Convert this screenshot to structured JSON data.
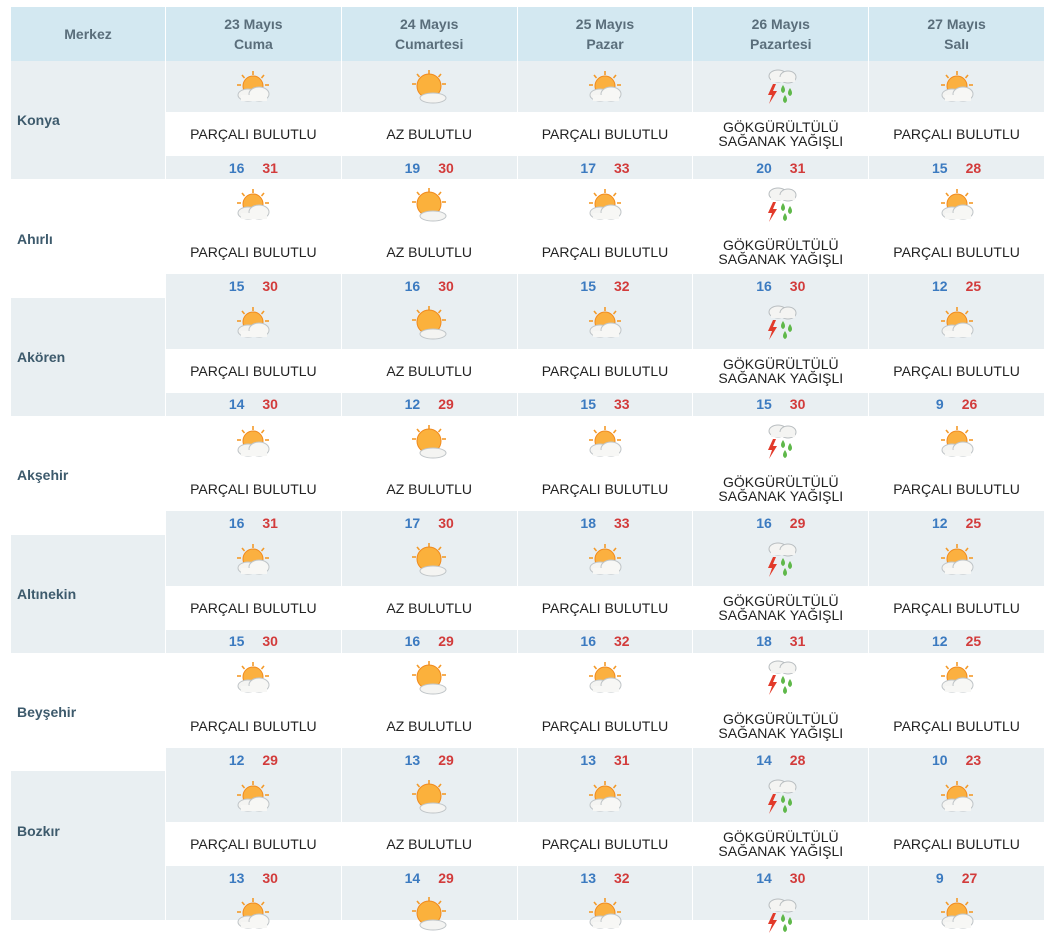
{
  "header": {
    "merkez": "Merkez",
    "days": [
      {
        "date": "23 Mayıs",
        "weekday": "Cuma"
      },
      {
        "date": "24 Mayıs",
        "weekday": "Cumartesi"
      },
      {
        "date": "25 Mayıs",
        "weekday": "Pazar"
      },
      {
        "date": "26 Mayıs",
        "weekday": "Pazartesi"
      },
      {
        "date": "27 Mayıs",
        "weekday": "Salı"
      }
    ]
  },
  "colors": {
    "header_bg": "#d3e8f1",
    "stripe_bg": "#e9eff2",
    "min_temp": "#3b7ac0",
    "max_temp": "#d23b3b"
  },
  "cities": [
    {
      "name": "Konya",
      "forecast": [
        {
          "icon": "partly-cloudy-icon",
          "desc": "PARÇALI BULUTLU",
          "min": "16",
          "max": "31"
        },
        {
          "icon": "mostly-sunny-icon",
          "desc": "AZ BULUTLU",
          "min": "19",
          "max": "30"
        },
        {
          "icon": "partly-cloudy-icon",
          "desc": "PARÇALI BULUTLU",
          "min": "17",
          "max": "33"
        },
        {
          "icon": "thunderstorm-icon",
          "desc": "GÖKGÜRÜLTÜLÜ SAĞANAK YAĞIŞLI",
          "min": "20",
          "max": "31"
        },
        {
          "icon": "partly-cloudy-icon",
          "desc": "PARÇALI BULUTLU",
          "min": "15",
          "max": "28"
        }
      ]
    },
    {
      "name": "Ahırlı",
      "forecast": [
        {
          "icon": "partly-cloudy-icon",
          "desc": "PARÇALI BULUTLU",
          "min": "15",
          "max": "30"
        },
        {
          "icon": "mostly-sunny-icon",
          "desc": "AZ BULUTLU",
          "min": "16",
          "max": "30"
        },
        {
          "icon": "partly-cloudy-icon",
          "desc": "PARÇALI BULUTLU",
          "min": "15",
          "max": "32"
        },
        {
          "icon": "thunderstorm-icon",
          "desc": "GÖKGÜRÜLTÜLÜ SAĞANAK YAĞIŞLI",
          "min": "16",
          "max": "30"
        },
        {
          "icon": "partly-cloudy-icon",
          "desc": "PARÇALI BULUTLU",
          "min": "12",
          "max": "25"
        }
      ]
    },
    {
      "name": "Akören",
      "forecast": [
        {
          "icon": "partly-cloudy-icon",
          "desc": "PARÇALI BULUTLU",
          "min": "14",
          "max": "30"
        },
        {
          "icon": "mostly-sunny-icon",
          "desc": "AZ BULUTLU",
          "min": "12",
          "max": "29"
        },
        {
          "icon": "partly-cloudy-icon",
          "desc": "PARÇALI BULUTLU",
          "min": "15",
          "max": "33"
        },
        {
          "icon": "thunderstorm-icon",
          "desc": "GÖKGÜRÜLTÜLÜ SAĞANAK YAĞIŞLI",
          "min": "15",
          "max": "30"
        },
        {
          "icon": "partly-cloudy-icon",
          "desc": "PARÇALI BULUTLU",
          "min": "9",
          "max": "26"
        }
      ]
    },
    {
      "name": "Akşehir",
      "forecast": [
        {
          "icon": "partly-cloudy-icon",
          "desc": "PARÇALI BULUTLU",
          "min": "16",
          "max": "31"
        },
        {
          "icon": "mostly-sunny-icon",
          "desc": "AZ BULUTLU",
          "min": "17",
          "max": "30"
        },
        {
          "icon": "partly-cloudy-icon",
          "desc": "PARÇALI BULUTLU",
          "min": "18",
          "max": "33"
        },
        {
          "icon": "thunderstorm-icon",
          "desc": "GÖKGÜRÜLTÜLÜ SAĞANAK YAĞIŞLI",
          "min": "16",
          "max": "29"
        },
        {
          "icon": "partly-cloudy-icon",
          "desc": "PARÇALI BULUTLU",
          "min": "12",
          "max": "25"
        }
      ]
    },
    {
      "name": "Altınekin",
      "forecast": [
        {
          "icon": "partly-cloudy-icon",
          "desc": "PARÇALI BULUTLU",
          "min": "15",
          "max": "30"
        },
        {
          "icon": "mostly-sunny-icon",
          "desc": "AZ BULUTLU",
          "min": "16",
          "max": "29"
        },
        {
          "icon": "partly-cloudy-icon",
          "desc": "PARÇALI BULUTLU",
          "min": "16",
          "max": "32"
        },
        {
          "icon": "thunderstorm-icon",
          "desc": "GÖKGÜRÜLTÜLÜ SAĞANAK YAĞIŞLI",
          "min": "18",
          "max": "31"
        },
        {
          "icon": "partly-cloudy-icon",
          "desc": "PARÇALI BULUTLU",
          "min": "12",
          "max": "25"
        }
      ]
    },
    {
      "name": "Beyşehir",
      "forecast": [
        {
          "icon": "partly-cloudy-icon",
          "desc": "PARÇALI BULUTLU",
          "min": "12",
          "max": "29"
        },
        {
          "icon": "mostly-sunny-icon",
          "desc": "AZ BULUTLU",
          "min": "13",
          "max": "29"
        },
        {
          "icon": "partly-cloudy-icon",
          "desc": "PARÇALI BULUTLU",
          "min": "13",
          "max": "31"
        },
        {
          "icon": "thunderstorm-icon",
          "desc": "GÖKGÜRÜLTÜLÜ SAĞANAK YAĞIŞLI",
          "min": "14",
          "max": "28"
        },
        {
          "icon": "partly-cloudy-icon",
          "desc": "PARÇALI BULUTLU",
          "min": "10",
          "max": "23"
        }
      ]
    },
    {
      "name": "Bozkır",
      "forecast": [
        {
          "icon": "partly-cloudy-icon",
          "desc": "PARÇALI BULUTLU",
          "min": "13",
          "max": "30"
        },
        {
          "icon": "mostly-sunny-icon",
          "desc": "AZ BULUTLU",
          "min": "14",
          "max": "29"
        },
        {
          "icon": "partly-cloudy-icon",
          "desc": "PARÇALI BULUTLU",
          "min": "13",
          "max": "32"
        },
        {
          "icon": "thunderstorm-icon",
          "desc": "GÖKGÜRÜLTÜLÜ SAĞANAK YAĞIŞLI",
          "min": "14",
          "max": "30"
        },
        {
          "icon": "partly-cloudy-icon",
          "desc": "PARÇALI BULUTLU",
          "min": "9",
          "max": "27"
        }
      ]
    }
  ],
  "partial_next_row_icons": [
    "partly-cloudy-icon",
    "mostly-sunny-icon",
    "partly-cloudy-icon",
    "thunderstorm-icon",
    "partly-cloudy-icon"
  ]
}
